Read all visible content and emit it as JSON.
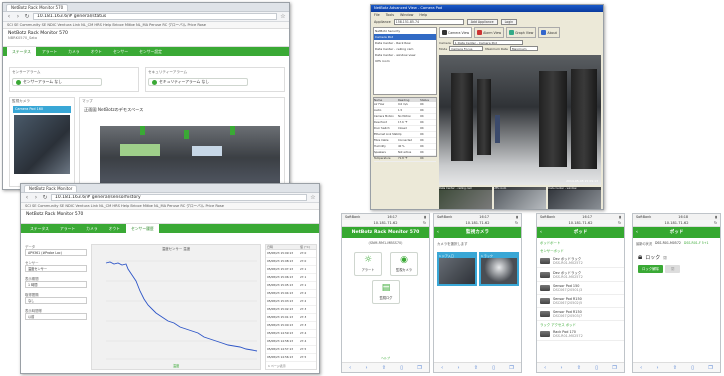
{
  "title_mark": "",
  "win1": {
    "tab": "NetBotz Rack Monitor 570",
    "url": "10.181.163.6/# general/status",
    "bookmarks": "SCI SE Community  SE NDIC Ventura Link  NL_CM  HRS Help  Bricoe Mitbe  NL_MA  Peruse  RC グローバル  Price  Rose",
    "device_title": "NetBotz Rack Monitor 570",
    "device_sub": "NBRK0570_Sato",
    "tabs": [
      "ステータス",
      "アラート",
      "カメラ",
      "オウト",
      "センサー",
      "センサー設定"
    ],
    "box_left_title": "センサーアラーム",
    "box_left_btn": "センサーアラーム なし",
    "box_right_title": "セキュリティーアラーム",
    "box_right_btn": "セキュリティーアラーム なし",
    "camera_label": "監視カメラ",
    "camera_item": "Camera Pod 160",
    "map_label": "マップ",
    "map_caption": "正面図 NetBotzのデモスペース"
  },
  "win2": {
    "tab": "NetBotz Rack Monitor",
    "url": "10.181.163.6/# general/sensorhistory",
    "bookmarks": "SCI SE Community  SE NDIC Ventura Link  NL_CM  HRS Help  Bricoe Mitbe  NL_MA  Peruse  RC グローバル  Price  Rose",
    "device_title": "NetBotz Rack Monitor 570",
    "tabs": [
      "ステータス",
      "アラート",
      "カメラ",
      "オウト",
      "センサー履歴"
    ],
    "side": [
      {
        "label": "データ",
        "value": "AP9361 (#Probe Lac)"
      },
      {
        "label": "センサー",
        "value": "温度センサー"
      },
      {
        "label": "表示期間",
        "value": "1 時間"
      },
      {
        "label": "取得間隔",
        "value": "なし"
      },
      {
        "label": "表示時間帯",
        "value": "以前"
      }
    ],
    "chart_label": "温度センサー 温度",
    "table_head": [
      "日時",
      "値 (°C)"
    ],
    "table_rows": [
      [
        "05/08/23 15:09:13",
        "27.0"
      ],
      [
        "05/08/23 15:08:13",
        "27.0"
      ],
      [
        "05/08/23 15:07:13",
        "27.1"
      ],
      [
        "05/08/23 15:06:13",
        "27.1"
      ],
      [
        "05/08/23 15:05:13",
        "27.1"
      ],
      [
        "05/08/23 15:04:13",
        "27.2"
      ],
      [
        "05/08/23 15:03:13",
        "27.2"
      ],
      [
        "05/08/23 15:02:13",
        "27.3"
      ],
      [
        "05/08/23 15:01:13",
        "27.3"
      ],
      [
        "05/08/23 15:00:13",
        "27.3"
      ],
      [
        "05/08/23 14:59:13",
        "27.4"
      ],
      [
        "05/08/23 14:58:13",
        "27.4"
      ],
      [
        "05/08/23 14:57:13",
        "27.5"
      ],
      [
        "05/08/23 14:56:13",
        "27.5"
      ]
    ],
    "footer": "1 ページ表示",
    "legend": "温度"
  },
  "advview": {
    "title": "NetBotz Advanced View - Camera Pod",
    "menu": [
      "File",
      "Tools",
      "Window",
      "Help"
    ],
    "appliance_label": "Appliance",
    "appliance_value": "158.151.85.74",
    "add_button": "Add Appliance",
    "login_button": "Login",
    "toolbar": [
      "Camera View",
      "Alarm View",
      "Graph View",
      "About"
    ],
    "tree": [
      "NetBotz Security",
      "Camera Pod",
      "Data Center - Rack Row",
      "Data Center - ceiling cam",
      "Data Center - window view",
      "UPS room"
    ],
    "camera_label": "Camera",
    "camera_value": "1 Data Center - Camera Pod",
    "mode_label": "Mode",
    "mode_value": "Camera Focus",
    "rate_label": "Maximum Rate",
    "rate_value": "Maximum",
    "props_head": [
      "Name",
      "Reading",
      "Status"
    ],
    "props": [
      [
        "Air Flow",
        "9.6 m/s",
        "OK"
      ],
      [
        "Audio",
        "1.5",
        "OK"
      ],
      [
        "Camera Motion",
        "No Motion",
        "OK"
      ],
      [
        "Dew Point",
        "17.6 °F",
        "OK"
      ],
      [
        "Door Switch",
        "Closed",
        "OK"
      ],
      [
        "Ethernet Link Status",
        "Up",
        "OK"
      ],
      [
        "Fibre Cable",
        "Connected",
        "OK"
      ],
      [
        "Humidity",
        "40 %",
        "OK"
      ],
      [
        "Speakers",
        "Not active",
        "OK"
      ],
      [
        "Temperature",
        "71.8 °F",
        "OK"
      ]
    ],
    "timestamp": "2014-05-08 15:09:13",
    "thumbs": [
      "Data Center - ceiling cam",
      "UPS room",
      "Data Center - window"
    ]
  },
  "phones": [
    {
      "status_left": "SoftBank",
      "status_mid": "16:17",
      "url": "10.181.71.62",
      "title": "NetBotz Rack Monitor 570",
      "subtitle": "(SNM-RM1-MBSS70)",
      "btn1": "アラート",
      "btn2": "監視カメラ",
      "btn3": "監視ログ",
      "footer": "ヘルプ"
    },
    {
      "status_left": "SoftBank",
      "status_mid": "16:17",
      "url": "10.181.71.62",
      "title": "監視カメラ",
      "subtitle": "カメラを選択します",
      "cam1": "1 ドア入口",
      "cam2": "1 ラック"
    },
    {
      "status_left": "SoftBank",
      "status_mid": "16:17",
      "url": "10.181.71.62",
      "title": "ポッド",
      "section1": "ポッドポート",
      "section2": "センサーポッド",
      "items": [
        {
          "name": "Dev ポッドラック",
          "sub": "DSS-R01-M02572"
        },
        {
          "name": "Dev ポッドラック",
          "sub": "DSS-R01-M02572"
        },
        {
          "name": "Sensor Pod 150",
          "sub": "DSC067(20501)3"
        },
        {
          "name": "Sensor Pod R150",
          "sub": "DSC067(20502)5"
        },
        {
          "name": "Sensor Pod R150",
          "sub": "DSC067(20503)7"
        }
      ],
      "section3": "ラック アクセス ポッド",
      "item_last": {
        "name": "Rack Pod 170",
        "sub": "DSS-R01-M02572"
      }
    },
    {
      "status_left": "SoftBank",
      "status_mid": "16:18",
      "url": "10.181.71.62",
      "title": "ポッド",
      "row_label": "最新の状況",
      "row_value1": "DSS-R01-M0572",
      "row_value2": "DSS-R01-F 5+1",
      "lock_label": "ロック",
      "lock_state": "閉",
      "btn_lock": "ロック解除",
      "btn_lock2": "閉"
    }
  ]
}
